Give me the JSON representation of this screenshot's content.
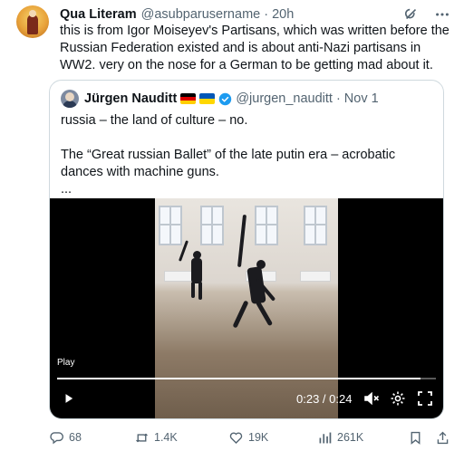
{
  "tweet": {
    "author_name": "Qua Literam",
    "author_handle": "@asubparusername",
    "separator": "·",
    "timestamp": "20h",
    "text": "this is from Igor Moiseyev's Partisans, which was written before the Russian Federation existed and is about anti-Nazi partisans in WW2. very on the nose for a German to be getting mad about it."
  },
  "quote": {
    "author_name": "Jürgen Nauditt",
    "author_handle": "@jurgen_nauditt",
    "separator": "·",
    "timestamp": "Nov 1",
    "line1": "russia – the land of culture – no.",
    "line2": "The “Great russian Ballet” of the late putin era – acrobatic dances with machine guns.",
    "line3": "..."
  },
  "video": {
    "label": "Play",
    "time_readout": "0:23 / 0:24",
    "progress": 0.96
  },
  "actions": {
    "replies": "68",
    "reposts": "1.4K",
    "likes": "19K",
    "views": "261K"
  },
  "icons": {
    "top": [
      "grok-icon",
      "more-icon"
    ],
    "video_controls": [
      "play-icon",
      "volume-mute-icon",
      "settings-icon",
      "fullscreen-icon"
    ],
    "action_bar": [
      "reply-icon",
      "repost-icon",
      "like-icon",
      "views-icon",
      "bookmark-icon",
      "share-icon"
    ]
  },
  "colors": {
    "text": "#0f1419",
    "secondary": "#536471",
    "border": "#cfd9de",
    "verified": "#1d9bf0"
  }
}
